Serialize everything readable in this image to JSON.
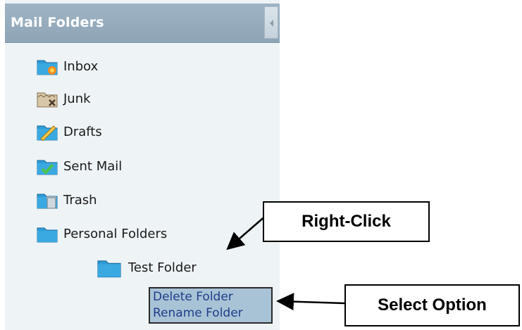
{
  "panel": {
    "title": "Mail Folders",
    "collapse_icon": "chevron-left-icon"
  },
  "folders": [
    {
      "label": "Inbox",
      "icon": "inbox-folder-icon"
    },
    {
      "label": "Junk",
      "icon": "junk-folder-icon"
    },
    {
      "label": "Drafts",
      "icon": "drafts-folder-icon"
    },
    {
      "label": "Sent Mail",
      "icon": "sent-folder-icon"
    },
    {
      "label": "Trash",
      "icon": "trash-folder-icon"
    },
    {
      "label": "Personal Folders",
      "icon": "folder-icon"
    },
    {
      "label": "Test Folder",
      "icon": "folder-icon"
    }
  ],
  "context_menu": {
    "items": [
      {
        "label": "Delete Folder"
      },
      {
        "label": "Rename Folder"
      }
    ]
  },
  "callouts": {
    "right_click": "Right-Click",
    "select_option": "Select Option"
  },
  "colors": {
    "header": "#8ea5b7",
    "panel_bg": "#eef3f6",
    "folder_blue": "#2f9bd6",
    "menu_bg": "#a9c3d6",
    "menu_text": "#1f3d8a"
  }
}
